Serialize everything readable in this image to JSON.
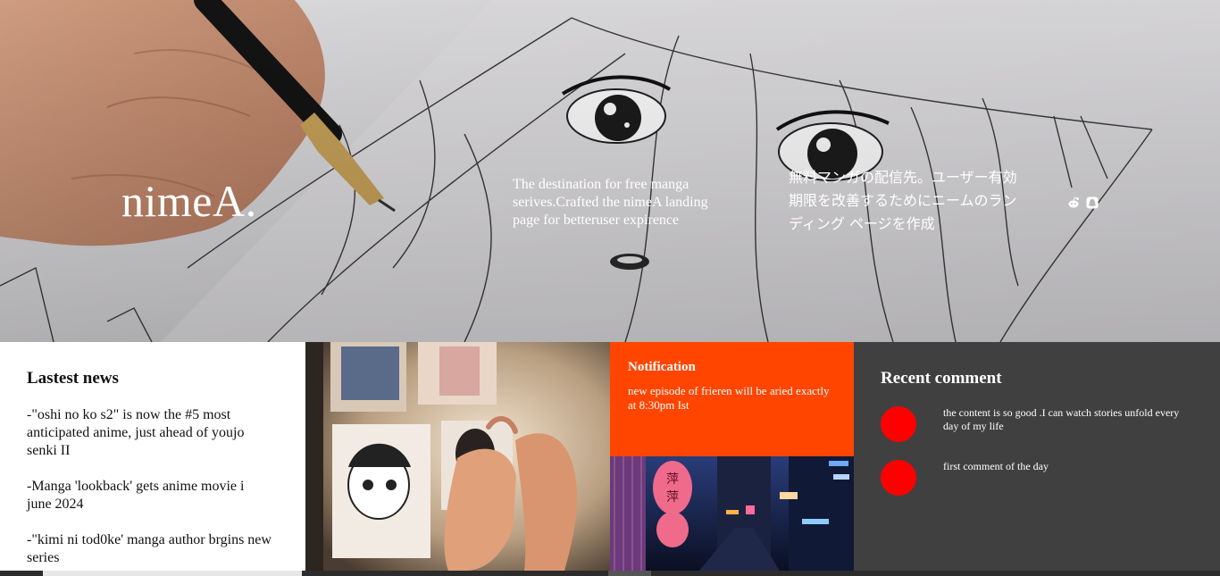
{
  "hero": {
    "brand": "nimeA.",
    "tagline_en": "The destination for free manga serives.Crafted the nimeA landing page for betteruser expirence",
    "tagline_jp": "無料マンガの配信先。ユーザー有効期限を改善するためにニームのランディング ページを作成",
    "social": [
      {
        "icon": "reddit-icon",
        "glyph": "◉"
      },
      {
        "icon": "snapchat-icon",
        "glyph": "▣"
      }
    ]
  },
  "news": {
    "title": "Lastest news",
    "items": [
      "-\"oshi no ko s2\" is now the #5 most anticipated anime, just ahead of youjo senki II",
      "-Manga 'lookback' gets anime movie i june 2024",
      "-\"kimi ni tod0ke' manga author brgins new series"
    ]
  },
  "notification": {
    "title": "Notification",
    "text": "new episode of frieren will be aried exactly at 8:30pm Ist"
  },
  "comments": {
    "title": "Recent comment",
    "items": [
      {
        "text": "the content is so good .I can watch stories unfold every day of my life"
      },
      {
        "text": "first comment of the day"
      }
    ]
  },
  "colors": {
    "accent": "#ff4500",
    "avatar": "#ff0000",
    "comments_bg": "#404040"
  }
}
